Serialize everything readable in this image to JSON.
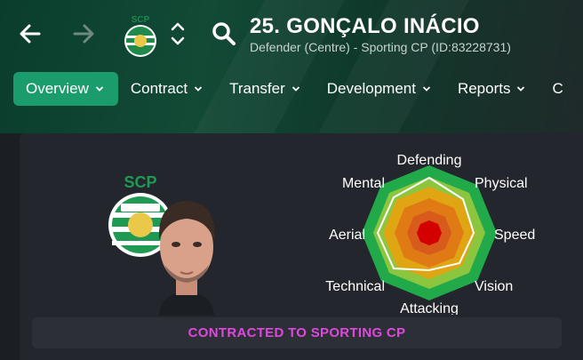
{
  "header": {
    "player_title": "25. GONÇALO INÁCIO",
    "player_subtitle": "Defender (Centre) - Sporting CP (ID:83228731)",
    "back_icon": "arrow-left-icon",
    "forward_icon": "arrow-right-icon",
    "club_crest": "sporting-cp-crest",
    "search_icon": "magnifier-icon"
  },
  "tabs": [
    {
      "label": "Overview",
      "active": true
    },
    {
      "label": "Contract",
      "active": false
    },
    {
      "label": "Transfer",
      "active": false
    },
    {
      "label": "Development",
      "active": false
    },
    {
      "label": "Reports",
      "active": false
    },
    {
      "label": "C",
      "active": false
    }
  ],
  "radar": {
    "labels": {
      "defending": "Defending",
      "physical": "Physical",
      "speed": "Speed",
      "vision": "Vision",
      "attacking": "Attacking",
      "technical": "Technical",
      "aerial": "Aerial",
      "mental": "Mental"
    }
  },
  "banner": {
    "text": "CONTRACTED TO SPORTING CP"
  },
  "colors": {
    "accent": "#1a9c6c",
    "banner_text": "#e146e0",
    "radar_outer": "#22a94a",
    "radar_inner": "#d40000"
  }
}
